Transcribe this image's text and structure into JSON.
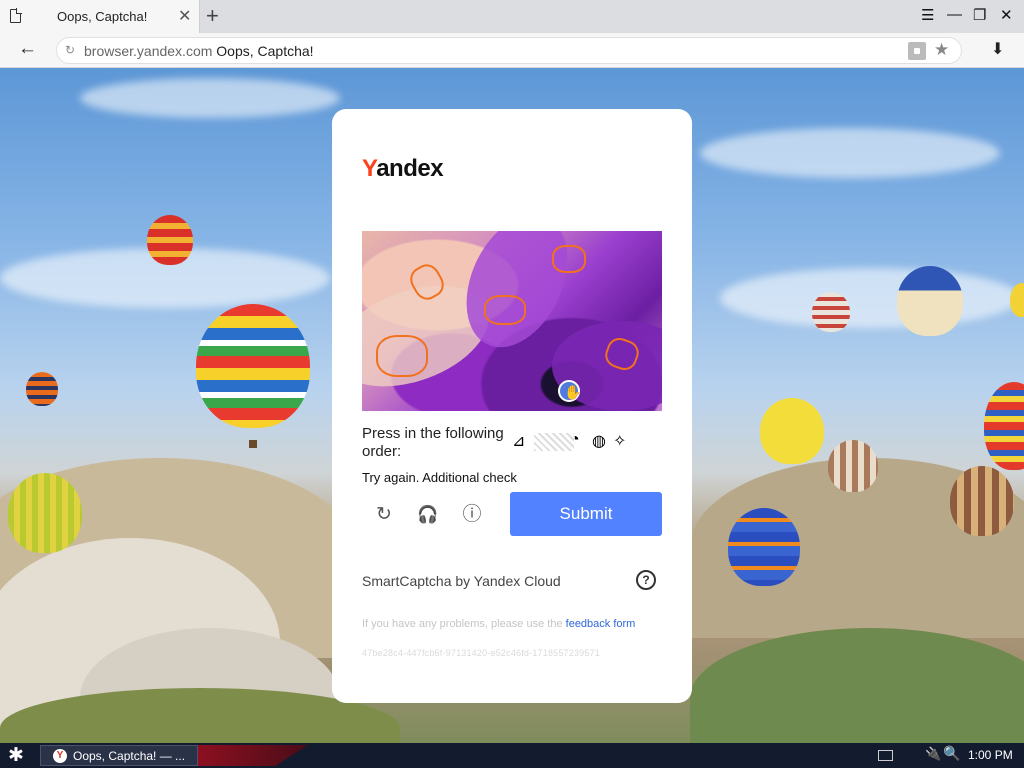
{
  "browser": {
    "tab_title": "Oops, Captcha!",
    "tab_close": "✕",
    "new_tab": "+",
    "back": "←",
    "reload": "↻",
    "url_host": "browser.yandex.com",
    "page_title": "Oops, Captcha!",
    "star": "★",
    "download": "⬇",
    "window_buttons": {
      "menu": "☰",
      "minimize": "—",
      "restore": "❐",
      "close": "✕"
    }
  },
  "captcha": {
    "logo_y": "Y",
    "logo_rest": "andex",
    "instruction": "Press in the following order:",
    "error": "Try again. Additional check",
    "refresh_icon": "↻",
    "audio_icon": "🎧",
    "info_icon": "ⓘ",
    "submit_label": "Submit",
    "provider": "SmartCaptcha by Yandex Cloud",
    "help_icon": "?",
    "feedback_prefix": "If you have any problems, please use the",
    "feedback_link": "feedback form",
    "request_hash": "47be28c4-447fcb6f-97131420-e52c46fd-1718557239571"
  },
  "taskbar": {
    "start_icon": "✱",
    "task_icon": "Y",
    "task_label": "Oops, Captcha! — ...",
    "network_icon": "🔌",
    "search_icon": "🔍",
    "clock": "1:00 PM"
  },
  "colors": {
    "brand_red": "#fc3f1d",
    "submit_blue": "#5282ff",
    "link_blue": "#2f67d8",
    "glyph_orange": "#f0721e"
  }
}
